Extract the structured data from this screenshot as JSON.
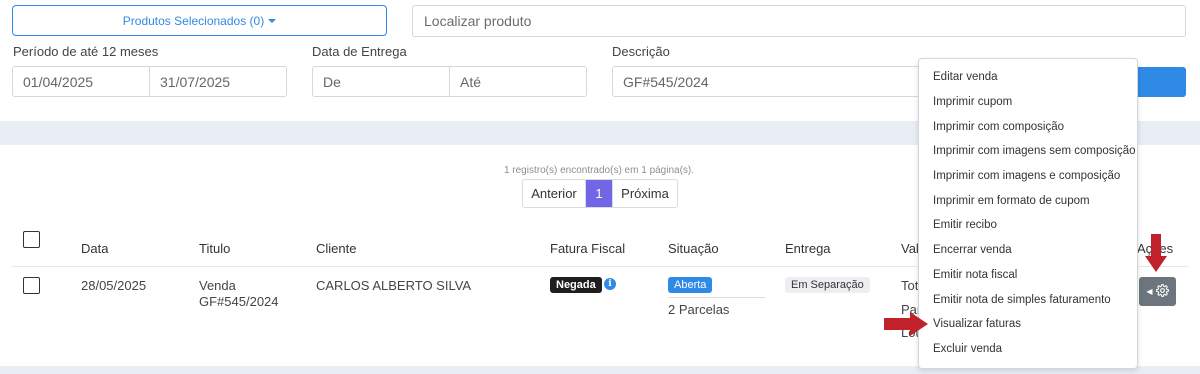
{
  "filters": {
    "produtos_button": "Produtos Selecionados (0)",
    "search_placeholder": "Localizar produto",
    "periodo_label": "Período de até 12 meses",
    "periodo_inicio": "01/04/2025",
    "periodo_fim": "31/07/2025",
    "entrega_label": "Data de Entrega",
    "entrega_de_placeholder": "De",
    "entrega_ate_placeholder": "Até",
    "descricao_label": "Descrição",
    "descricao_value": "GF#545/2024"
  },
  "results": {
    "found_text": "1 registro(s) encontrado(s) em 1 página(s).",
    "pager": {
      "previous": "Anterior",
      "current": "1",
      "next": "Próxima"
    }
  },
  "table": {
    "headers": {
      "data": "Data",
      "titulo": "Titulo",
      "cliente": "Cliente",
      "fatura_fiscal": "Fatura Fiscal",
      "situacao": "Situação",
      "entrega": "Entrega",
      "valor": "Val",
      "acoes": "Ações"
    },
    "rows": [
      {
        "data": "28/05/2025",
        "titulo_line1": "Venda",
        "titulo_line2": "GF#545/2024",
        "cliente": "CARLOS ALBERTO SILVA",
        "fatura_fiscal": "Negada",
        "situacao": "Aberta",
        "parcelas": "2 Parcelas",
        "entrega": "Em Separação",
        "valor_line1": "Tot",
        "valor_line2": "Par",
        "valor_line3": "Lou"
      }
    ]
  },
  "actions_menu": {
    "items": [
      "Editar venda",
      "Imprimir cupom",
      "Imprimir com composição",
      "Imprimir com imagens sem composição",
      "Imprimir com imagens e composição",
      "Imprimir em formato de cupom",
      "Emitir recibo",
      "Encerrar venda",
      "Emitir nota fiscal",
      "Emitir nota de simples faturamento",
      "Visualizar faturas",
      "Excluir venda"
    ]
  },
  "colors": {
    "primary": "#2f8ae6",
    "page_active": "#7066e6",
    "arrow_red": "#c0212b",
    "gear_button": "#6c757d"
  },
  "icons": {
    "gear": "gear-icon",
    "info": "info-icon",
    "caret": "caret-down-icon"
  }
}
